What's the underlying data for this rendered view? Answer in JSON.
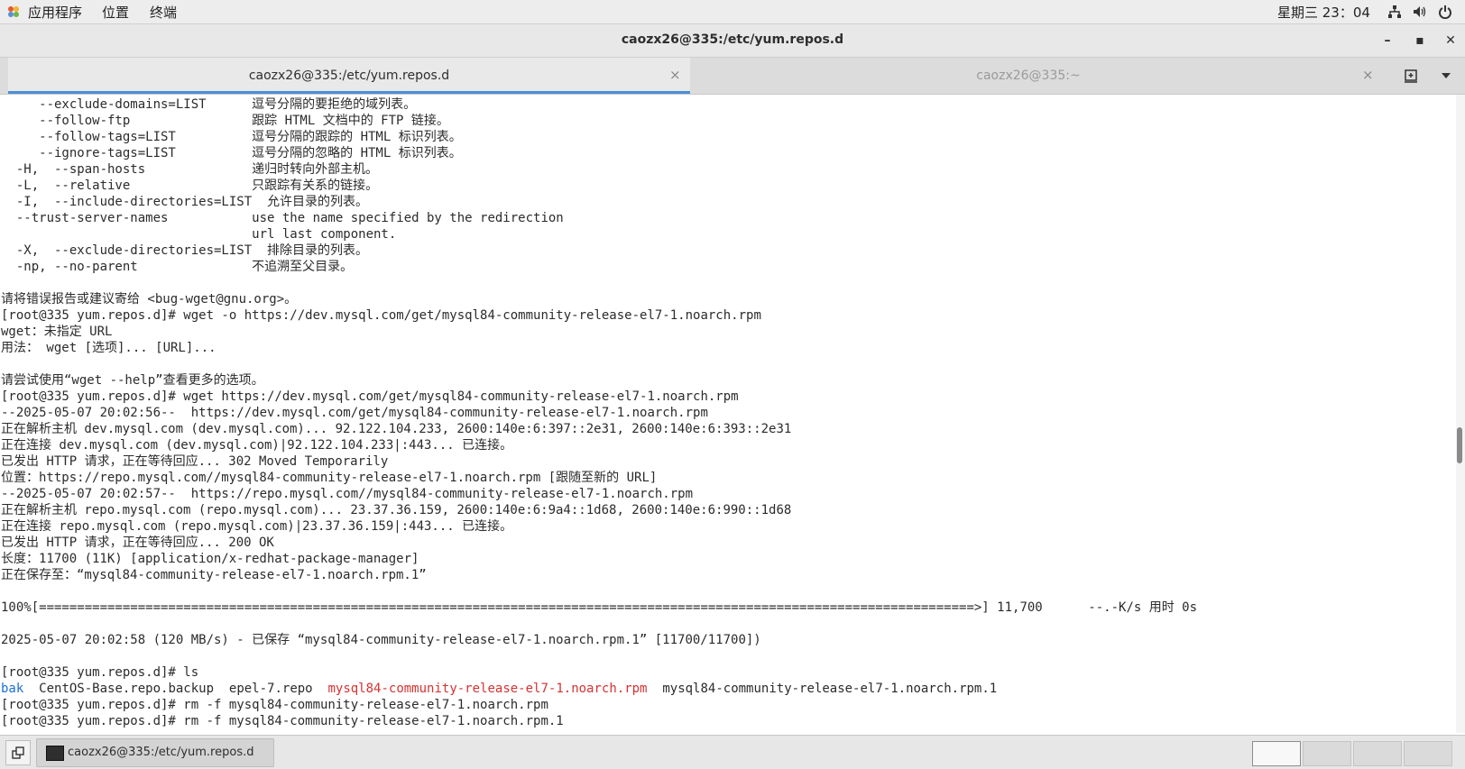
{
  "topbar": {
    "applications": "应用程序",
    "places": "位置",
    "terminal": "终端",
    "clock": "星期三 23：04",
    "icons": [
      "network-icon",
      "volume-icon",
      "power-icon"
    ]
  },
  "window": {
    "title": "caozx26@335:/etc/yum.repos.d",
    "minimize": "–",
    "maximize": "▪",
    "close": "✕"
  },
  "tabs": [
    {
      "label": "caozx26@335:/etc/yum.repos.d",
      "active": true,
      "close": "×"
    },
    {
      "label": "caozx26@335:~",
      "active": false,
      "close": "×"
    }
  ],
  "terminal": {
    "lines": [
      "     --exclude-domains=LIST      逗号分隔的要拒绝的域列表。",
      "     --follow-ftp                跟踪 HTML 文档中的 FTP 链接。",
      "     --follow-tags=LIST          逗号分隔的跟踪的 HTML 标识列表。",
      "     --ignore-tags=LIST          逗号分隔的忽略的 HTML 标识列表。",
      "  -H,  --span-hosts              递归时转向外部主机。",
      "  -L,  --relative                只跟踪有关系的链接。",
      "  -I,  --include-directories=LIST  允许目录的列表。",
      "  --trust-server-names           use the name specified by the redirection",
      "                                 url last component.",
      "  -X,  --exclude-directories=LIST  排除目录的列表。",
      "  -np, --no-parent               不追溯至父目录。",
      "",
      "请将错误报告或建议寄给 <bug-wget@gnu.org>。",
      "[root@335 yum.repos.d]# wget -o https://dev.mysql.com/get/mysql84-community-release-el7-1.noarch.rpm",
      "wget：未指定 URL",
      "用法： wget [选项]... [URL]...",
      "",
      "请尝试使用“wget --help”查看更多的选项。",
      "[root@335 yum.repos.d]# wget https://dev.mysql.com/get/mysql84-community-release-el7-1.noarch.rpm",
      "--2025-05-07 20:02:56--  https://dev.mysql.com/get/mysql84-community-release-el7-1.noarch.rpm",
      "正在解析主机 dev.mysql.com (dev.mysql.com)... 92.122.104.233, 2600:140e:6:397::2e31, 2600:140e:6:393::2e31",
      "正在连接 dev.mysql.com (dev.mysql.com)|92.122.104.233|:443... 已连接。",
      "已发出 HTTP 请求，正在等待回应... 302 Moved Temporarily",
      "位置：https://repo.mysql.com//mysql84-community-release-el7-1.noarch.rpm [跟随至新的 URL]",
      "--2025-05-07 20:02:57--  https://repo.mysql.com//mysql84-community-release-el7-1.noarch.rpm",
      "正在解析主机 repo.mysql.com (repo.mysql.com)... 23.37.36.159, 2600:140e:6:9a4::1d68, 2600:140e:6:990::1d68",
      "正在连接 repo.mysql.com (repo.mysql.com)|23.37.36.159|:443... 已连接。",
      "已发出 HTTP 请求，正在等待回应... 200 OK",
      "长度：11700 (11K) [application/x-redhat-package-manager]",
      "正在保存至：“mysql84-community-release-el7-1.noarch.rpm.1”",
      "",
      "100%[===========================================================================================================================>] 11,700      --.-K/s 用时 0s",
      "",
      "2025-05-07 20:02:58 (120 MB/s) - 已保存 “mysql84-community-release-el7-1.noarch.rpm.1” [11700/11700])",
      "",
      "[root@335 yum.repos.d]# ls"
    ],
    "ls_output": {
      "dir": "bak",
      "f1": "CentOS-Base.repo.backup",
      "f2": "epel-7.repo",
      "f3_red": "mysql84-community-release-el7-1.noarch.rpm",
      "f4": "mysql84-community-release-el7-1.noarch.rpm.1",
      "sep": "  "
    },
    "tail_lines": [
      "[root@335 yum.repos.d]# rm -f mysql84-community-release-el7-1.noarch.rpm",
      "[root@335 yum.repos.d]# rm -f mysql84-community-release-el7-1.noarch.rpm.1"
    ]
  },
  "taskbar": {
    "task_label": "caozx26@335:/etc/yum.repos.d",
    "workspaces": 4,
    "active_workspace": 1
  }
}
